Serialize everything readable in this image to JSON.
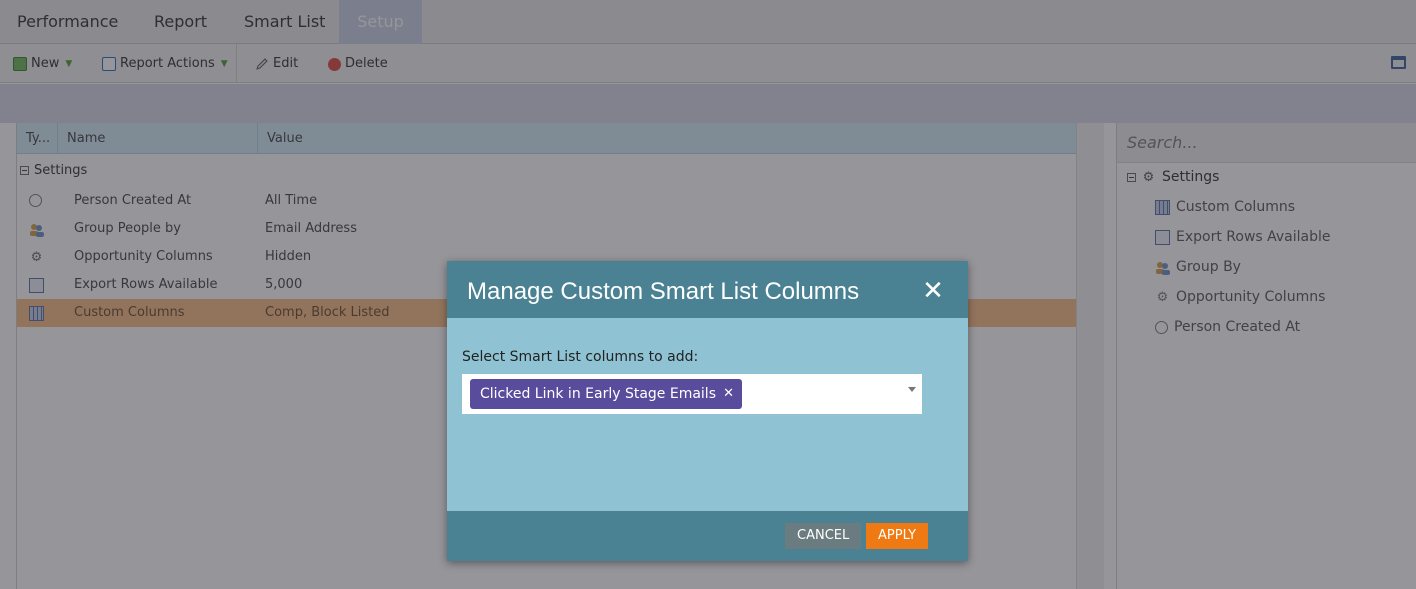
{
  "tabs": [
    {
      "label": "Performance"
    },
    {
      "label": "Report"
    },
    {
      "label": "Smart List"
    },
    {
      "label": "Setup"
    }
  ],
  "toolbar": {
    "new_label": "New",
    "report_actions_label": "Report Actions",
    "edit_label": "Edit",
    "delete_label": "Delete"
  },
  "grid": {
    "headers": [
      "Ty...",
      "Name",
      "Value"
    ],
    "group_label": "Settings",
    "rows": [
      {
        "icon": "clock-icon",
        "name": "Person Created At",
        "value": "All Time"
      },
      {
        "icon": "people-icon",
        "name": "Group People by",
        "value": "Email Address"
      },
      {
        "icon": "gear-icon",
        "name": "Opportunity Columns",
        "value": "Hidden"
      },
      {
        "icon": "export-rows-icon",
        "name": "Export Rows Available",
        "value": "5,000"
      },
      {
        "icon": "columns-grid-icon",
        "name": "Custom Columns",
        "value": "Comp, Block Listed",
        "selected": true
      }
    ]
  },
  "sidebar": {
    "search_placeholder": "Search...",
    "root_label": "Settings",
    "items": [
      {
        "icon": "columns-grid-icon",
        "label": "Custom Columns"
      },
      {
        "icon": "export-rows-icon",
        "label": "Export Rows Available"
      },
      {
        "icon": "people-icon",
        "label": "Group By"
      },
      {
        "icon": "gear-icon",
        "label": "Opportunity Columns"
      },
      {
        "icon": "clock-icon",
        "label": "Person Created At"
      }
    ]
  },
  "modal": {
    "title": "Manage Custom Smart List Columns",
    "label": "Select Smart List columns to add:",
    "selected_chip": "Clicked Link in Early Stage Emails",
    "cancel_label": "CANCEL",
    "apply_label": "APPLY"
  },
  "colors": {
    "modal_header": "#4a8293",
    "modal_body": "#8fc3d4",
    "chip": "#5a4c9c",
    "apply": "#ef7a14",
    "cancel": "#6b7c80",
    "selected_row": "#f9c48f"
  }
}
